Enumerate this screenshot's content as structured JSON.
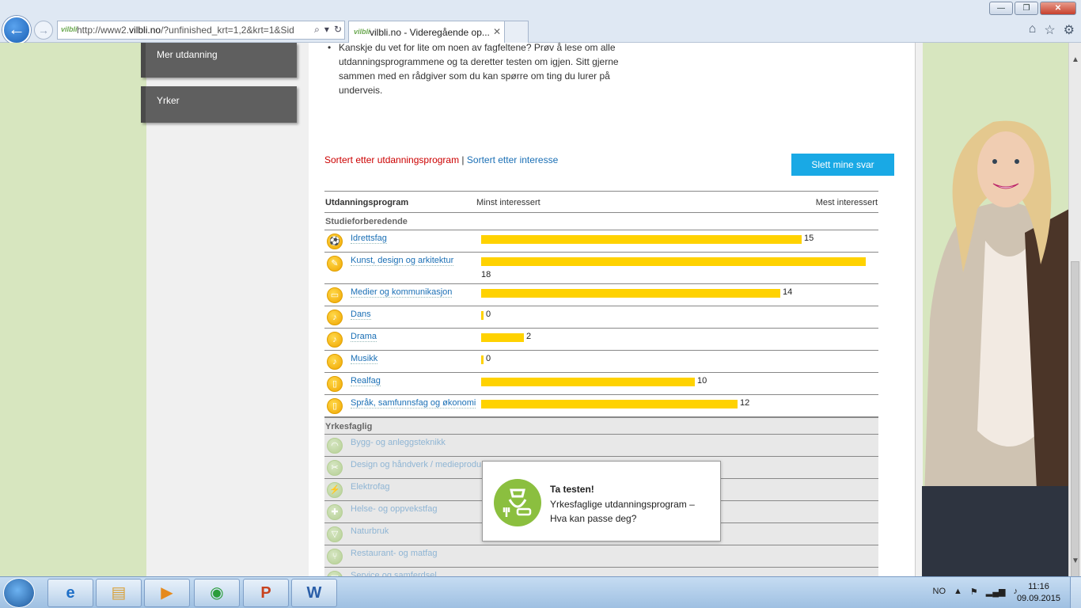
{
  "browser": {
    "url_prefix": "http://www2.",
    "url_domain": "vilbli.no",
    "url_rest": "/?unfinished_krt=1,2&krt=1&Sid",
    "tab_title": "vilbli.no - Videregående op...",
    "favicon_text": "vilbli"
  },
  "sidebar": {
    "items": [
      {
        "label": "Mer utdanning"
      },
      {
        "label": "Yrker"
      }
    ]
  },
  "intro": {
    "bullet": "•",
    "text": "Kanskje du vet for lite om noen av fagfeltene? Prøv å lese om alle utdanningsprogrammene og ta deretter testen om igjen. Sitt gjerne sammen med en rådgiver som du kan spørre om ting du lurer på underveis."
  },
  "sort": {
    "by_program": "Sortert etter utdanningsprogram",
    "separator": " | ",
    "by_interest": "Sortert etter interesse"
  },
  "delete_button": "Slett mine svar",
  "table": {
    "col_program": "Utdanningsprogram",
    "col_least": "Minst interessert",
    "col_most": "Mest interessert",
    "max_value": 18,
    "sections": [
      {
        "title": "Studieforberedende",
        "rows": [
          {
            "name": "Idrettsfag",
            "value": 15,
            "icon": "sport-icon"
          },
          {
            "name": "Kunst, design og arkitektur",
            "value": 18,
            "icon": "art-icon"
          },
          {
            "name": "Medier og kommunikasjon",
            "value": 14,
            "icon": "media-icon"
          },
          {
            "name": "Dans",
            "value": 0,
            "icon": "music-note-icon"
          },
          {
            "name": "Drama",
            "value": 2,
            "icon": "music-note-icon"
          },
          {
            "name": "Musikk",
            "value": 0,
            "icon": "music-note-icon"
          },
          {
            "name": "Realfag",
            "value": 10,
            "icon": "book-icon"
          },
          {
            "name": "Språk, samfunnsfag og økonomi",
            "value": 12,
            "icon": "book-icon"
          }
        ]
      },
      {
        "title": "Yrkesfaglig",
        "rows": [
          {
            "name": "Bygg- og anleggsteknikk",
            "icon": "helmet-icon"
          },
          {
            "name": "Design og håndverk / medieprodu",
            "icon": "scissors-icon"
          },
          {
            "name": "Elektrofag",
            "icon": "plug-icon"
          },
          {
            "name": "Helse- og oppvekstfag",
            "icon": "bandage-icon"
          },
          {
            "name": "Naturbruk",
            "icon": "cow-icon"
          },
          {
            "name": "Restaurant- og matfag",
            "icon": "fork-icon"
          },
          {
            "name": "Service og samferdsel",
            "icon": "bus-icon"
          }
        ]
      }
    ]
  },
  "popup": {
    "title": "Ta testen!",
    "text": "Yrkesfaglige utdanningsprogram – Hva kan passe deg?"
  },
  "taskbar": {
    "language": "NO",
    "time": "11:16",
    "date": "09.09.2015"
  }
}
